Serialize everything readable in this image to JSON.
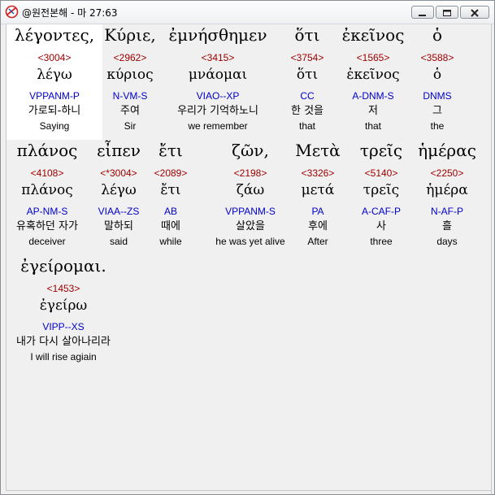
{
  "window": {
    "title": "@원전본해 - 마 27:63"
  },
  "words": [
    {
      "greek": "λέγοντες,",
      "strong": "<3004>",
      "lexeme": "λέγω",
      "parse": "VPPANM-P",
      "korean": "가로되-하니",
      "english": "Saying"
    },
    {
      "greek": "Κύριε,",
      "strong": "<2962>",
      "lexeme": "κύριος",
      "parse": "N-VM-S",
      "korean": "주여",
      "english": "Sir"
    },
    {
      "greek": "ἐμνήσθημεν",
      "strong": "<3415>",
      "lexeme": "μνάομαι",
      "parse": "VIAO--XP",
      "korean": "우리가 기억하노니",
      "english": "we remember"
    },
    {
      "greek": "ὅτι",
      "strong": "<3754>",
      "lexeme": "ὅτι",
      "parse": "CC",
      "korean": "한 것을",
      "english": "that"
    },
    {
      "greek": "ἐκεῖνος",
      "strong": "<1565>",
      "lexeme": "ἐκεῖνος",
      "parse": "A-DNM-S",
      "korean": "저",
      "english": "that"
    },
    {
      "greek": "ὁ",
      "strong": "<3588>",
      "lexeme": "ὁ",
      "parse": "DNMS",
      "korean": "그",
      "english": "the"
    },
    {
      "greek": "πλάνος",
      "strong": "<4108>",
      "lexeme": "πλάνος",
      "parse": "AP-NM-S",
      "korean": "유혹하던 자가",
      "english": "deceiver"
    },
    {
      "greek": "εἶπεν",
      "strong": "<*3004>",
      "lexeme": "λέγω",
      "parse": "VIAA--ZS",
      "korean": "말하되",
      "english": "said"
    },
    {
      "greek": "ἔτι",
      "strong": "<2089>",
      "lexeme": "ἔτι",
      "parse": "AB",
      "korean": "때에",
      "english": "while"
    },
    {
      "greek": "ζῶν,",
      "strong": "<2198>",
      "lexeme": "ζάω",
      "parse": "VPPANM-S",
      "korean": "살았을",
      "english": "he was yet alive"
    },
    {
      "greek": "Μετὰ",
      "strong": "<3326>",
      "lexeme": "μετά",
      "parse": "PA",
      "korean": "후에",
      "english": "After"
    },
    {
      "greek": "τρεῖς",
      "strong": "<5140>",
      "lexeme": "τρεῖς",
      "parse": "A-CAF-P",
      "korean": "사",
      "english": "three"
    },
    {
      "greek": "ἡμέρας",
      "strong": "<2250>",
      "lexeme": "ἡμέρα",
      "parse": "N-AF-P",
      "korean": "흘",
      "english": "days"
    },
    {
      "greek": "ἐγείρομαι.",
      "strong": "<1453>",
      "lexeme": "ἐγείρω",
      "parse": "VIPP--XS",
      "korean": "내가 다시 살아나리라",
      "english": "I will rise agiain"
    }
  ]
}
